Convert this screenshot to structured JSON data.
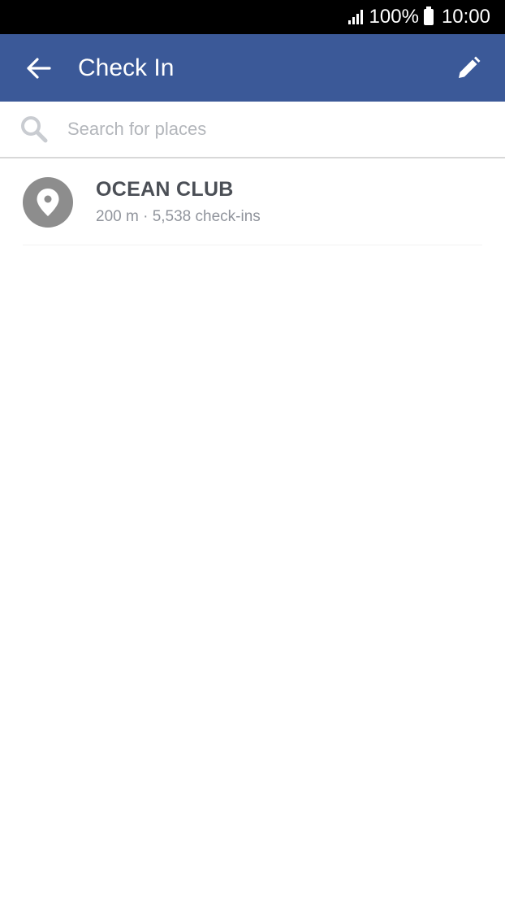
{
  "status_bar": {
    "battery_percent": "100%",
    "time": "10:00"
  },
  "app_bar": {
    "title": "Check In",
    "back_icon": "arrow-left-icon",
    "edit_icon": "pencil-icon",
    "background_color": "#3b5998"
  },
  "search": {
    "placeholder": "Search for places",
    "value": ""
  },
  "places": [
    {
      "name": "OCEAN CLUB",
      "meta": "200 m · 5,538 check-ins",
      "icon": "location-pin-icon"
    }
  ]
}
